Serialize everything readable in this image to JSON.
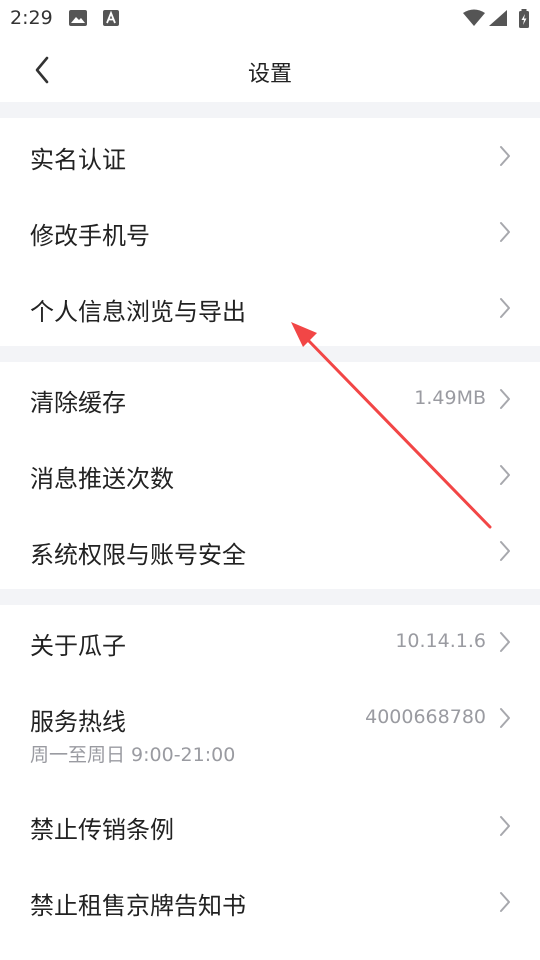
{
  "status_bar": {
    "time": "2:29",
    "icons": [
      "image-icon",
      "a-notification-icon",
      "wifi-icon",
      "signal-icon",
      "battery-charging-icon"
    ]
  },
  "header": {
    "title": "设置",
    "back_icon": "chevron-left-icon"
  },
  "groups": [
    {
      "items": [
        {
          "label": "实名认证",
          "value": ""
        },
        {
          "label": "修改手机号",
          "value": ""
        },
        {
          "label": "个人信息浏览与导出",
          "value": ""
        }
      ]
    },
    {
      "items": [
        {
          "label": "清除缓存",
          "value": "1.49MB"
        },
        {
          "label": "消息推送次数",
          "value": ""
        },
        {
          "label": "系统权限与账号安全",
          "value": ""
        }
      ]
    },
    {
      "items": [
        {
          "label": "关于瓜子",
          "value": "10.14.1.6"
        },
        {
          "label": "服务热线",
          "value": "4000668780",
          "sub": "周一至周日 9:00-21:00"
        },
        {
          "label": "禁止传销条例",
          "value": ""
        },
        {
          "label": "禁止租售京牌告知书",
          "value": ""
        }
      ]
    }
  ],
  "annotation": {
    "type": "arrow",
    "color": "#f24646",
    "points_to": "个人信息浏览与导出"
  },
  "colors": {
    "separator": "#f3f4f7",
    "secondary_text": "#9a9ba1",
    "chevron": "#a7a8ad"
  }
}
